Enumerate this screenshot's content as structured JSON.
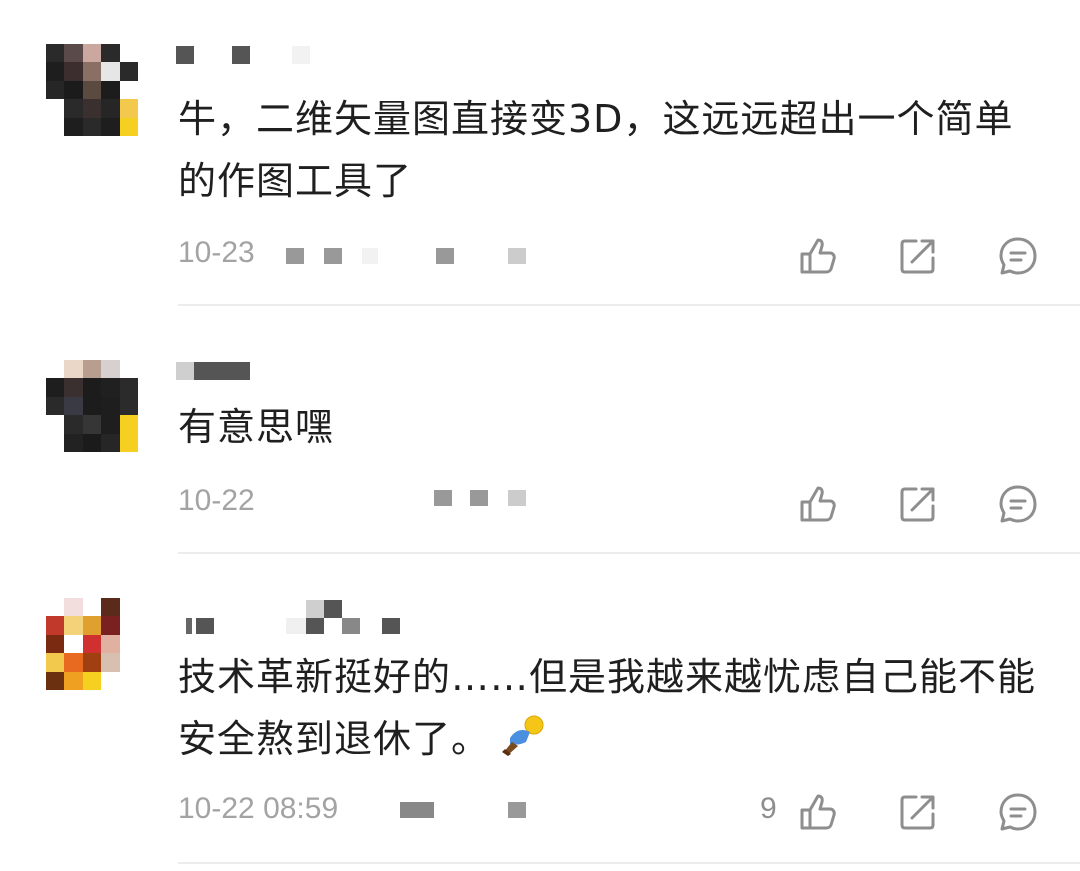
{
  "icons": {
    "like": "thumbs-up-icon",
    "share": "share-icon",
    "reply": "reply-icon"
  },
  "comments": [
    {
      "text": "牛，二维矢量图直接变3D，这远远超出一个简单的作图工具了",
      "date": "10-23",
      "likes": ""
    },
    {
      "text": "有意思嘿",
      "date": "10-22",
      "likes": ""
    },
    {
      "text": "技术革新挺好的……但是我越来越忧虑自己能不能安全熬到退休了。",
      "date": "10-22 08:59",
      "likes": "9"
    }
  ],
  "colors": {
    "text": "#1f1f1f",
    "meta": "#a3a3a3",
    "icon": "#8e8e8e",
    "divider": "#ececec"
  }
}
